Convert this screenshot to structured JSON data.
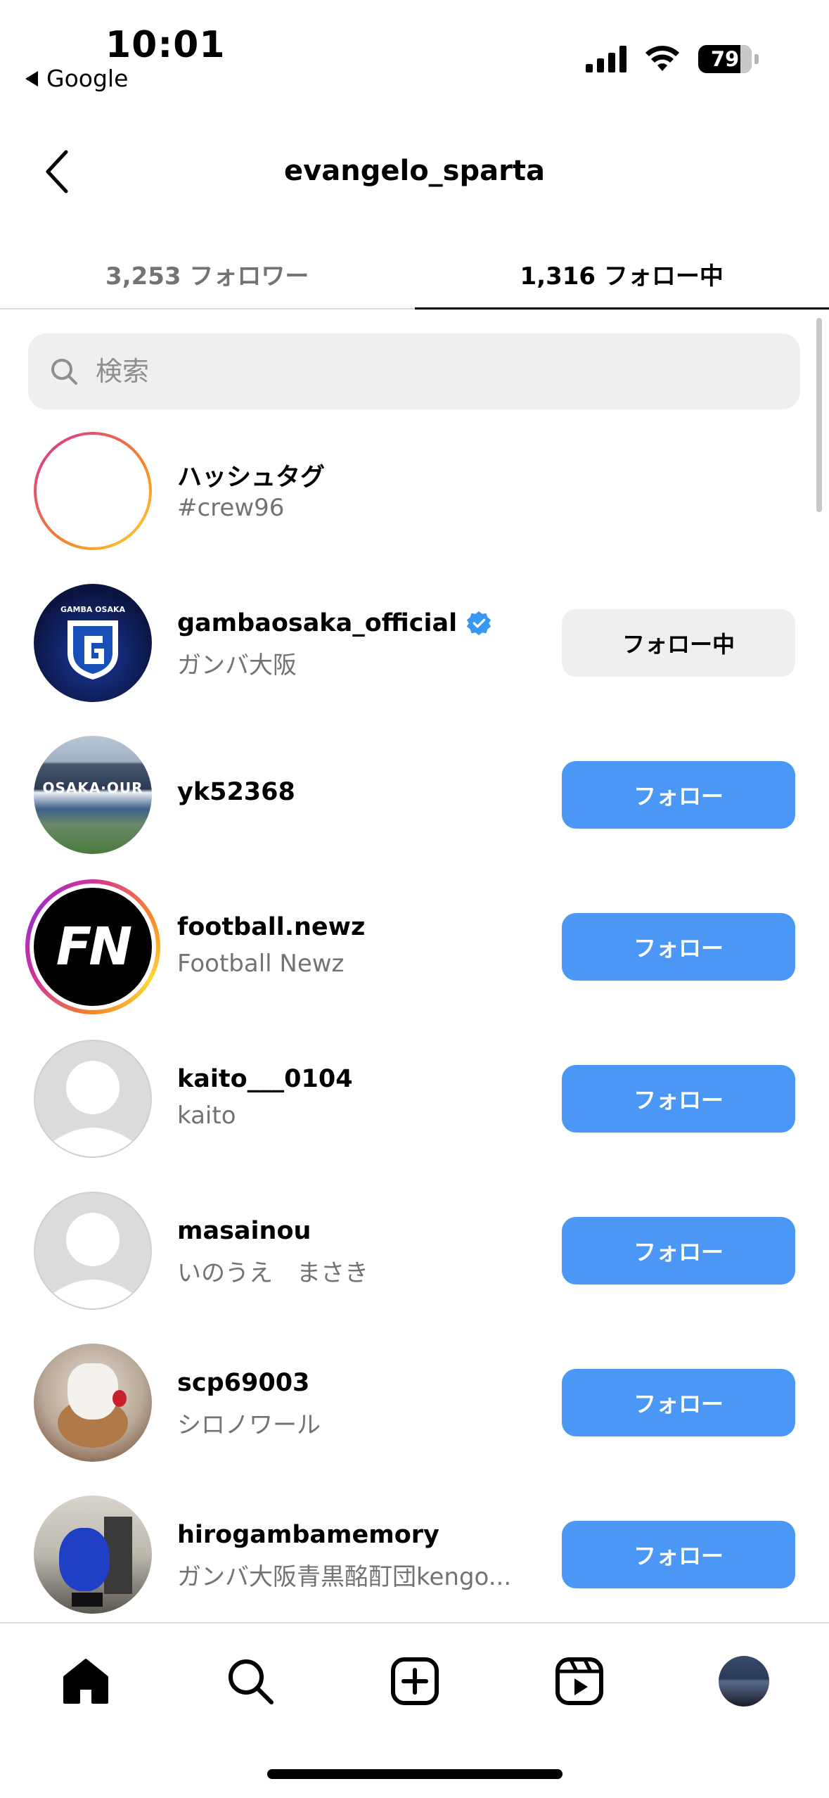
{
  "status_bar": {
    "time": "10:01",
    "back_app": "Google",
    "battery": "79"
  },
  "header": {
    "title": "evangelo_sparta",
    "back_icon": "chevron-left-icon"
  },
  "tabs": [
    {
      "label": "3,253 フォロワー",
      "active": false
    },
    {
      "label": "1,316 フォロー中",
      "active": true
    }
  ],
  "search": {
    "placeholder": "検索",
    "value": ""
  },
  "list": [
    {
      "username": "ハッシュタグ",
      "subtitle": "#crew96",
      "verified": false,
      "button": ""
    },
    {
      "username": "gambaosaka_official",
      "subtitle": "ガンバ大阪",
      "verified": true,
      "button": "フォロー中"
    },
    {
      "username": "yk52368",
      "subtitle": "",
      "verified": false,
      "button": "フォロー"
    },
    {
      "username": "football.newz",
      "subtitle": "Football Newz",
      "verified": false,
      "button": "フォロー"
    },
    {
      "username": "kaito___0104",
      "subtitle": "kaito",
      "verified": false,
      "button": "フォロー"
    },
    {
      "username": "masainou",
      "subtitle": "いのうえ　まさき",
      "verified": false,
      "button": "フォロー"
    },
    {
      "username": "scp69003",
      "subtitle": "シロノワール",
      "verified": false,
      "button": "フォロー"
    },
    {
      "username": "hirogambamemory",
      "subtitle": "ガンバ大阪青黒酩酊団kengo...",
      "verified": false,
      "button": "フォロー"
    }
  ],
  "avatar_texts": {
    "gamba_badge": "GAMBA OSAKA",
    "fn_logo": "FN"
  },
  "bottom_nav": [
    "home-icon",
    "search-icon",
    "create-icon",
    "reels-icon",
    "profile-avatar"
  ],
  "colors": {
    "follow_button": "#4a97f5",
    "following_button": "#efefef",
    "verified": "#3897f0"
  }
}
